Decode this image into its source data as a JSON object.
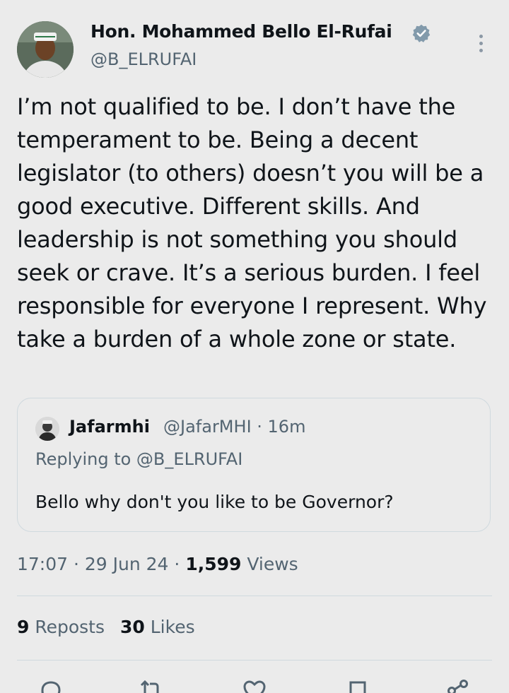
{
  "author": {
    "display_name": "Hon. Mohammed Bello El-Rufai",
    "handle": "@B_ELRUFAI",
    "verified": true,
    "avatar_icon": "profile-photo-icon"
  },
  "tweet": {
    "text": "I’m not qualified to be. I don’t have the temperament to be. Being a decent legislator (to others) doesn’t you will be a good executive. Different skills. And leadership is not something you should seek or crave. It’s a serious burden. I feel responsible for everyone I represent. Why take a burden of a whole zone or state."
  },
  "quote": {
    "name": "Jafarmhi",
    "handle_time": "@JafarMHI · 16m",
    "replying_to": "Replying to @B_ELRUFAI",
    "text": "Bello why don't you like to be Governor?"
  },
  "meta": {
    "time_date": "17:07 · 29 Jun 24 · ",
    "views_count": "1,599",
    "views_label": " Views"
  },
  "stats": {
    "reposts_count": "9",
    "reposts_label": " Reposts",
    "likes_count": "30",
    "likes_label": " Likes"
  },
  "actions": [
    "reply-icon",
    "repost-icon",
    "like-icon",
    "bookmark-icon",
    "share-icon"
  ],
  "colors": {
    "background": "#ebebeb",
    "text": "#0f1419",
    "secondary": "#536471",
    "border": "#cfd9de",
    "verified_badge": "#829aab"
  }
}
